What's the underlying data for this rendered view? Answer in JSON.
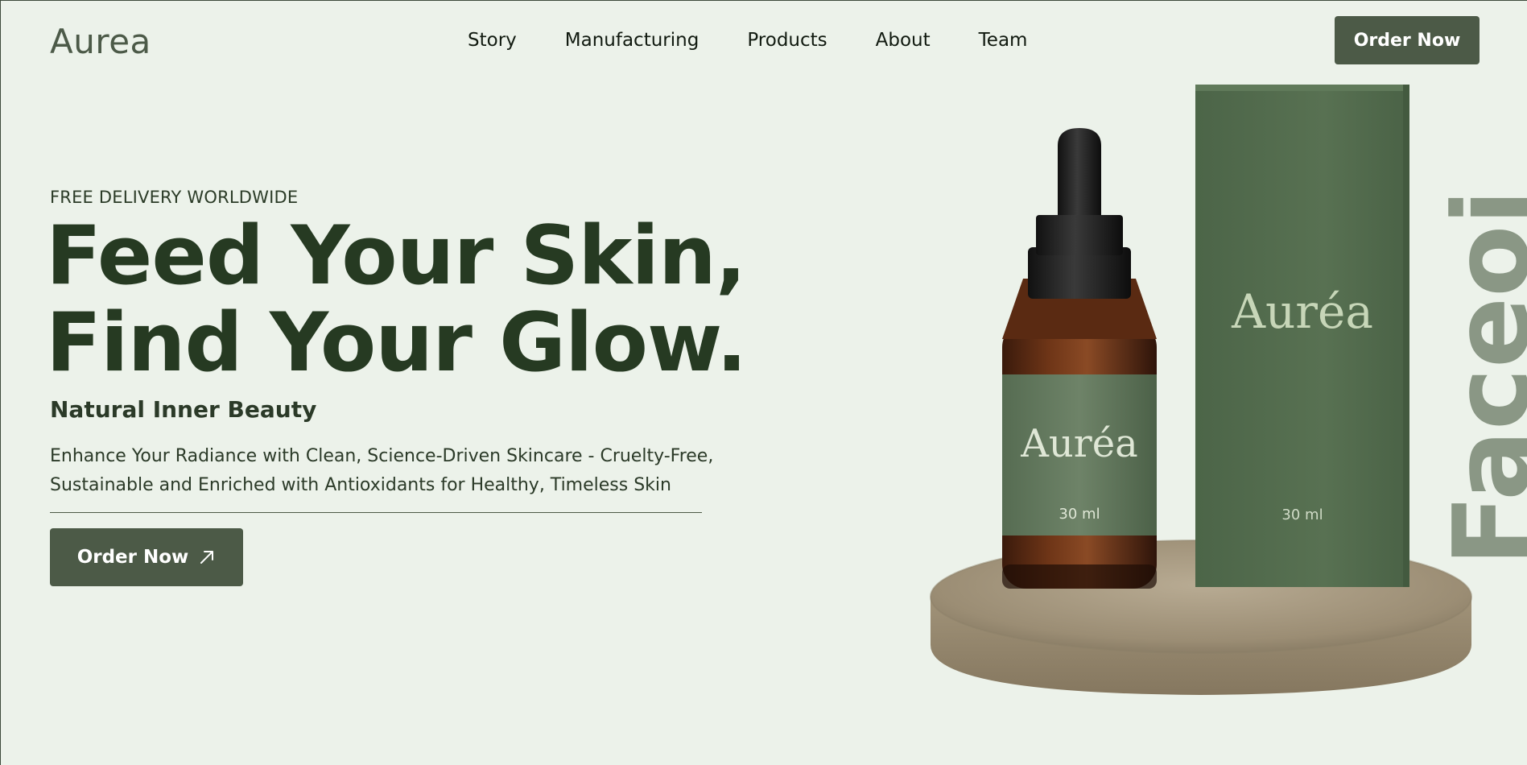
{
  "header": {
    "logo": "Aurea",
    "nav": [
      "Story",
      "Manufacturing",
      "Products",
      "About",
      "Team"
    ],
    "order_label": "Order Now"
  },
  "hero": {
    "eyebrow": "FREE DELIVERY WORLDWIDE",
    "headline_line1": "Feed Your Skin,",
    "headline_line2": "Find Your Glow.",
    "subhead": "Natural Inner Beauty",
    "description": "Enhance Your Radiance with Clean, Science-Driven Skincare - Cruelty-Free, Sustainable and Enriched with Antioxidants for Healthy, Timeless Skin",
    "cta_label": "Order Now",
    "cta_icon": "arrow-up-right-icon"
  },
  "product": {
    "bottle_brand": "Auréa",
    "bottle_volume": "30 ml",
    "box_brand": "Auréa",
    "box_volume": "30 ml",
    "vertical_word": "Faceoil"
  },
  "colors": {
    "background": "#ecf2ea",
    "accent": "#4c5a47",
    "headline": "#263a22",
    "box": "#4f6a4a",
    "vertical_word": "#8a9785"
  }
}
